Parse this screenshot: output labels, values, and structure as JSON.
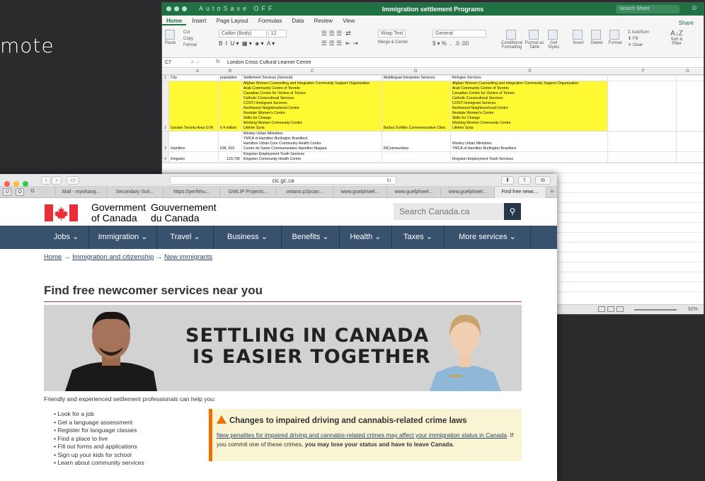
{
  "slide": {
    "partial_word": "mote"
  },
  "excel": {
    "title": "Immigration settlement Programs",
    "quick_access": "AutoSave  OFF",
    "search_placeholder": "Search Sheet",
    "tabs": [
      "Home",
      "Insert",
      "Page Layout",
      "Formulas",
      "Data",
      "Review",
      "View"
    ],
    "share": "Share",
    "ribbon": {
      "paste": "Paste",
      "cut": "Cut",
      "copy": "Copy",
      "format": "Format",
      "font": "Calibri (Body)",
      "size": "12",
      "wrap": "Wrap Text",
      "merge": "Merge & Center",
      "number_format": "General",
      "conditional": "Conditional Formatting",
      "format_table": "Format as Table",
      "cell_styles": "Cell Styles",
      "insert": "Insert",
      "delete": "Delete",
      "format_cells": "Format",
      "autosum": "AutoSum",
      "fill": "Fill",
      "clear": "Clear",
      "sort": "Sort & Filter"
    },
    "cell_ref": "C7",
    "fx": "fx",
    "formula_value": "London Cross Cultural Learner Centre",
    "columns": [
      "A",
      "B",
      "C",
      "D",
      "E",
      "F",
      "G"
    ],
    "header_row": [
      "City",
      "population",
      "Settlement Services (General)",
      "Multilingual Interpreter Services",
      "Refugee Services"
    ],
    "row2": {
      "city": "Greater Toronto Area GTA",
      "population": "6.4 million",
      "settlement": [
        "Afghan Women Counselling and Integration Community Support Organization",
        "Arab Community Centre of Toronto",
        "Canadian Centre for Victims of Torture",
        "Catholic Crosscultural Services",
        "COSTI Immigrant Services",
        "Northwood Neighbourhood Centre",
        "Rexdale Women's Centre",
        "Skills for Change",
        "Working Women Community Centre",
        "Lifeline Syria"
      ],
      "interpreter": "Barbra Schlifer Commemorative Clinic",
      "refugee": [
        "Afghan Women Counselling and Integration Community Support Organization",
        "Arab Community Centre of Toronto",
        "Canadian Centre for Victims of Torture",
        "Catholic Crosscultural Services",
        "COSTI Immigrant Services",
        "Northwood Neighbourhood Centre",
        "Rexdale Women's Centre",
        "Skills for Change",
        "Working Women Community Centre",
        "Lifeline Syria"
      ]
    },
    "row3": {
      "city": "Hamilton",
      "population": "536, 915",
      "settlement": [
        "Wesley Urban Ministries",
        "YMCA of Hamilton Burlington Brantford",
        "Hamilton Urban Core Community Health Centre",
        "Centre de Sante Communautaire Hamilton Niagara"
      ],
      "interpreter": "INCommunities",
      "refugee": [
        "Wesley Urban Ministries",
        "YMCA of Hamilton Burlington Brantford"
      ]
    },
    "row4": {
      "city": "Kingston",
      "population": "123,795",
      "settlement": [
        "Kingston Employment Youth Services",
        "Kingston Community Health Centre"
      ],
      "refugee": [
        "Kingston Employment Youth Services"
      ]
    },
    "zoom": "92%"
  },
  "browser": {
    "url": "cic.gc.ca",
    "tabs": [
      "Mail - myoharaj...",
      "Secondary Suit...",
      "https://perthhu...",
      "GWLIP Projects...",
      "ontario.p2pcan...",
      "www.guelphwel...",
      "www.guelphwel...",
      "www.guelphwel...",
      "Find free newc..."
    ]
  },
  "site": {
    "gov_en": [
      "Government",
      "of Canada"
    ],
    "gov_fr": [
      "Gouvernement",
      "du Canada"
    ],
    "search_placeholder": "Search Canada.ca",
    "menu": [
      "Jobs ⌄",
      "Immigration ⌄",
      "Travel ⌄",
      "Business ⌄",
      "Benefits ⌄",
      "Health ⌄",
      "Taxes ⌄",
      "More services ⌄"
    ],
    "breadcrumb": [
      "Home",
      "Immigration and citizenship",
      "New immigrants"
    ],
    "title": "Find free newcomer services near you",
    "banner_line1": "SETTLING IN CANADA",
    "banner_line2": "IS EASIER TOGETHER",
    "intro": "Friendly and experienced settlement professionals can help you:",
    "services": [
      "Look for a job",
      "Get a language assessment",
      "Register for language classes",
      "Find a place to live",
      "Fill out forms and applications",
      "Sign up your kids for school",
      "Learn about community services"
    ],
    "alert": {
      "heading": "Changes to impaired driving and cannabis-related crime laws",
      "link": "New penalties for impaired driving and cannabis-related crimes may affect your immigration status in Canada",
      "text1": ". If you commit one of these crimes, ",
      "bold": "you may lose your status and have to leave Canada."
    }
  }
}
